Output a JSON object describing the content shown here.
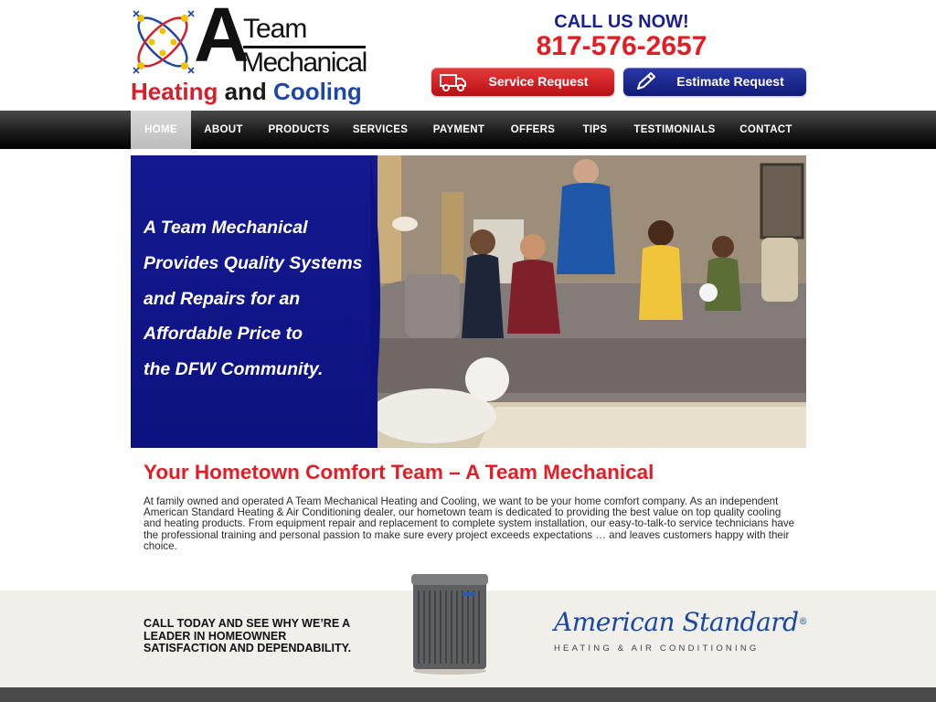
{
  "colors": {
    "brand_red": "#e31d25",
    "brand_blue": "#1a1f8f",
    "nav_bg": "#1c1c1c",
    "panel_blue": "#0c1280",
    "band_bg": "#f1efea"
  },
  "logo": {
    "letter": "A",
    "team": "Team",
    "mechanical": "Mechanical",
    "heating": "Heating",
    "and": "and",
    "cooling": "Cooling",
    "icon": "atom-snowflake-logo-icon"
  },
  "contact": {
    "call_label": "CALL US NOW!",
    "phone": "817-576-2657"
  },
  "buttons": {
    "service": {
      "label": "Service Request",
      "icon": "truck-icon"
    },
    "estimate": {
      "label": "Estimate Request",
      "icon": "pencil-icon"
    }
  },
  "nav": {
    "items": [
      {
        "label": "HOME"
      },
      {
        "label": "ABOUT"
      },
      {
        "label": "PRODUCTS"
      },
      {
        "label": "SERVICES"
      },
      {
        "label": "PAYMENT"
      },
      {
        "label": "OFFERS"
      },
      {
        "label": "TIPS"
      },
      {
        "label": "TESTIMONIALS"
      },
      {
        "label": "CONTACT"
      }
    ],
    "active": "HOME"
  },
  "hero": {
    "lines": [
      "A Team Mechanical",
      "Provides Quality Systems",
      "and Repairs for an",
      "Affordable Price to",
      "the DFW Community."
    ]
  },
  "main": {
    "headline": "Your Hometown Comfort Team – A Team Mechanical",
    "intro": "At family owned and operated A Team Mechanical Heating and Cooling, we want to be your home comfort company. As an independent American Standard Heating & Air Conditioning dealer, our hometown team is dedicated to providing the best value on top quality cooling and heating products. From equipment repair and replacement to complete system installation, our easy-to-talk-to service technicians have the professional training and personal passion to make sure every project exceeds expectations … and leaves customers happy with their choice."
  },
  "band": {
    "cta_lines": [
      "CALL TODAY AND SEE WHY WE’RE A",
      "LEADER IN HOMEOWNER",
      "SATISFACTION AND DEPENDABILITY."
    ],
    "brand_name": "American Standard",
    "brand_mark": "®",
    "brand_sub": "HEATING & AIR CONDITIONING"
  }
}
